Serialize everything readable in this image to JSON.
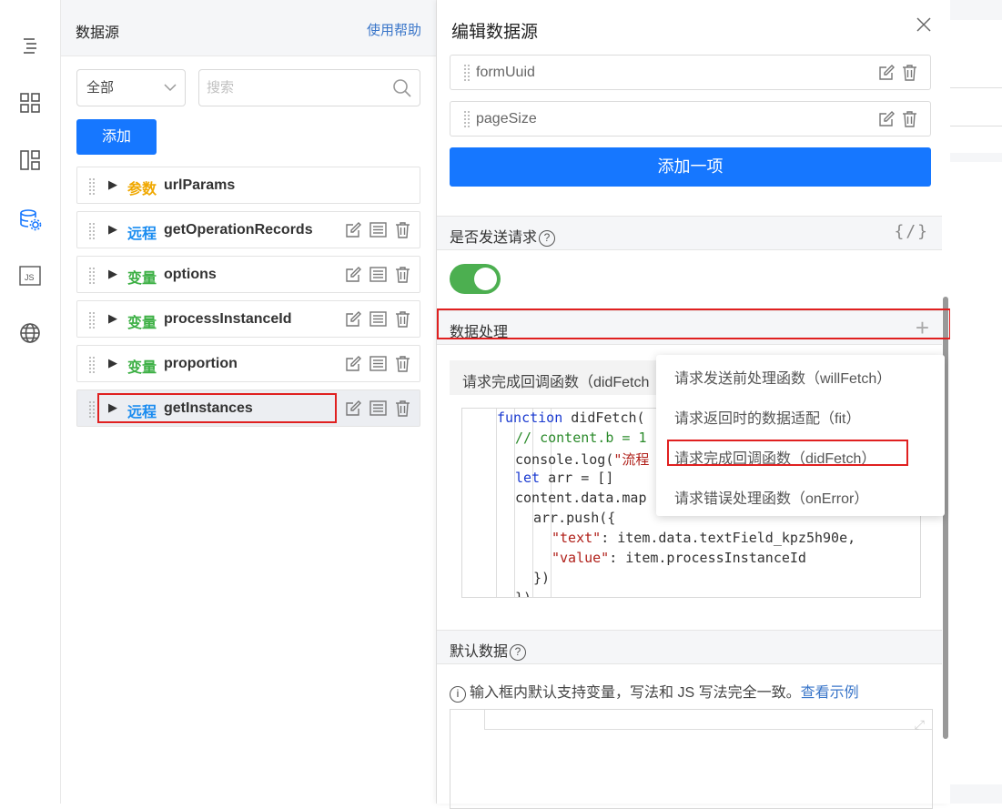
{
  "rail": {
    "items": [
      {
        "icon": "outline-tree-icon"
      },
      {
        "icon": "grid-icon"
      },
      {
        "icon": "layout-icon"
      },
      {
        "icon": "datasource-gear-icon",
        "active": true
      },
      {
        "icon": "js-icon",
        "label": "JS"
      },
      {
        "icon": "globe-icon"
      }
    ]
  },
  "datasource_panel": {
    "title": "数据源",
    "help_link": "使用帮助",
    "filter_value": "全部",
    "search_placeholder": "搜索",
    "add_button": "添加",
    "items": [
      {
        "tag": "参数",
        "tag_type": "param",
        "name": "urlParams",
        "actions": false
      },
      {
        "tag": "远程",
        "tag_type": "remote",
        "name": "getOperationRecords",
        "actions": true
      },
      {
        "tag": "变量",
        "tag_type": "var",
        "name": "options",
        "actions": true
      },
      {
        "tag": "变量",
        "tag_type": "var",
        "name": "processInstanceId",
        "actions": true
      },
      {
        "tag": "变量",
        "tag_type": "var",
        "name": "proportion",
        "actions": true
      },
      {
        "tag": "远程",
        "tag_type": "remote",
        "name": "getInstances",
        "actions": true,
        "selected": true
      }
    ]
  },
  "drawer": {
    "title": "编辑数据源",
    "params": [
      "formUuid",
      "pageSize"
    ],
    "add_item_button": "添加一项",
    "send_request_label": "是否发送请求",
    "send_request_enabled": true,
    "code_toggle_icon": "{/}",
    "data_processing_label": "数据处理",
    "function_tab": "请求完成回调函数（didFetch",
    "code_lines": [
      {
        "indent": 0,
        "parts": [
          [
            "kw",
            "function"
          ],
          [
            "",
            " didFetch("
          ]
        ]
      },
      {
        "indent": 1,
        "parts": [
          [
            "cm",
            "// content.b = 1"
          ]
        ]
      },
      {
        "indent": 1,
        "parts": [
          [
            "",
            "console.log("
          ],
          [
            "str",
            "\"流程"
          ]
        ]
      },
      {
        "indent": 1,
        "parts": [
          [
            "kw",
            "let"
          ],
          [
            "",
            " arr = []"
          ]
        ]
      },
      {
        "indent": 1,
        "parts": [
          [
            "",
            "content.data.map"
          ]
        ]
      },
      {
        "indent": 2,
        "parts": [
          [
            "",
            "arr.push({"
          ]
        ]
      },
      {
        "indent": 3,
        "parts": [
          [
            "str",
            "\"text\""
          ],
          [
            "",
            ": item.data.textField_kpz5h90e,"
          ]
        ]
      },
      {
        "indent": 3,
        "parts": [
          [
            "str",
            "\"value\""
          ],
          [
            "",
            ": item.processInstanceId"
          ]
        ]
      },
      {
        "indent": 2,
        "parts": [
          [
            "",
            "})"
          ]
        ]
      },
      {
        "indent": 1,
        "parts": [
          [
            "",
            "})"
          ]
        ]
      }
    ],
    "default_data_label": "默认数据",
    "info_text": "输入框内默认支持变量，写法和 JS 写法完全一致。",
    "info_link": "查看示例"
  },
  "menu": {
    "items": [
      "请求发送前处理函数（willFetch）",
      "请求返回时的数据适配（fit）",
      "请求完成回调函数（didFetch）",
      "请求错误处理函数（onError）"
    ],
    "highlighted_index": 2
  },
  "colors": {
    "primary": "#1677ff",
    "param_tag": "#f0a800",
    "remote_tag": "#1a8cf0",
    "var_tag": "#3db045",
    "toggle_on": "#4caf50",
    "highlight_box": "#e02020"
  }
}
